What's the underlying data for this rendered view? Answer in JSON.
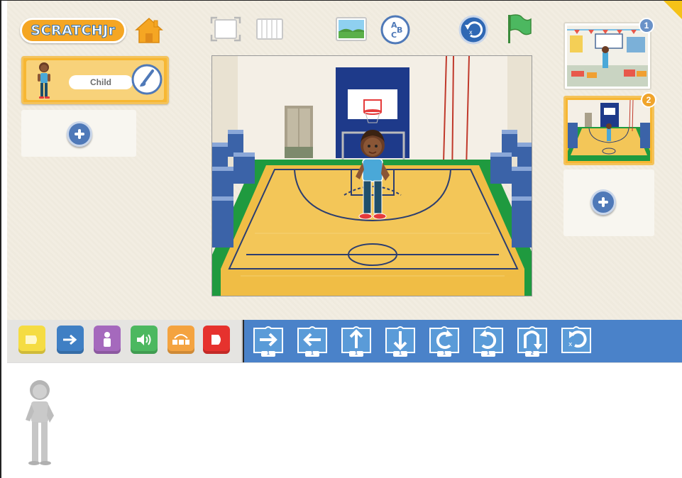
{
  "app": {
    "name": "ScratchJr",
    "logo_text": "SCRATCHJr"
  },
  "toolbar": {
    "home": "home-icon",
    "fullscreen": "fullscreen-icon",
    "grid": "grid-icon",
    "background": "background-icon",
    "text": "text-icon",
    "reset": "reset-icon",
    "green_flag": "green-flag-icon"
  },
  "sprites": {
    "items": [
      {
        "name": "Child",
        "selected": true
      }
    ]
  },
  "pages": {
    "items": [
      {
        "number": "1",
        "scene": "classroom",
        "selected": false
      },
      {
        "number": "2",
        "scene": "basketball-court",
        "selected": true
      }
    ]
  },
  "palette": {
    "categories": [
      {
        "name": "triggering",
        "color": "#f5dc43"
      },
      {
        "name": "motion",
        "color": "#3f7fc4"
      },
      {
        "name": "looks",
        "color": "#a569bd"
      },
      {
        "name": "sound",
        "color": "#4cb860"
      },
      {
        "name": "control",
        "color": "#f4a340"
      },
      {
        "name": "end",
        "color": "#e6322e"
      }
    ],
    "blocks": [
      {
        "name": "move-right",
        "num": "1"
      },
      {
        "name": "move-left",
        "num": "1"
      },
      {
        "name": "move-up",
        "num": "1"
      },
      {
        "name": "move-down",
        "num": "1"
      },
      {
        "name": "turn-right",
        "num": "1"
      },
      {
        "name": "turn-left",
        "num": "1"
      },
      {
        "name": "hop",
        "num": "2"
      },
      {
        "name": "go-home",
        "num": ""
      }
    ]
  },
  "colors": {
    "accent_orange": "#f7b733",
    "palette_blue": "#4a82c9",
    "background": "#f2ede1"
  }
}
